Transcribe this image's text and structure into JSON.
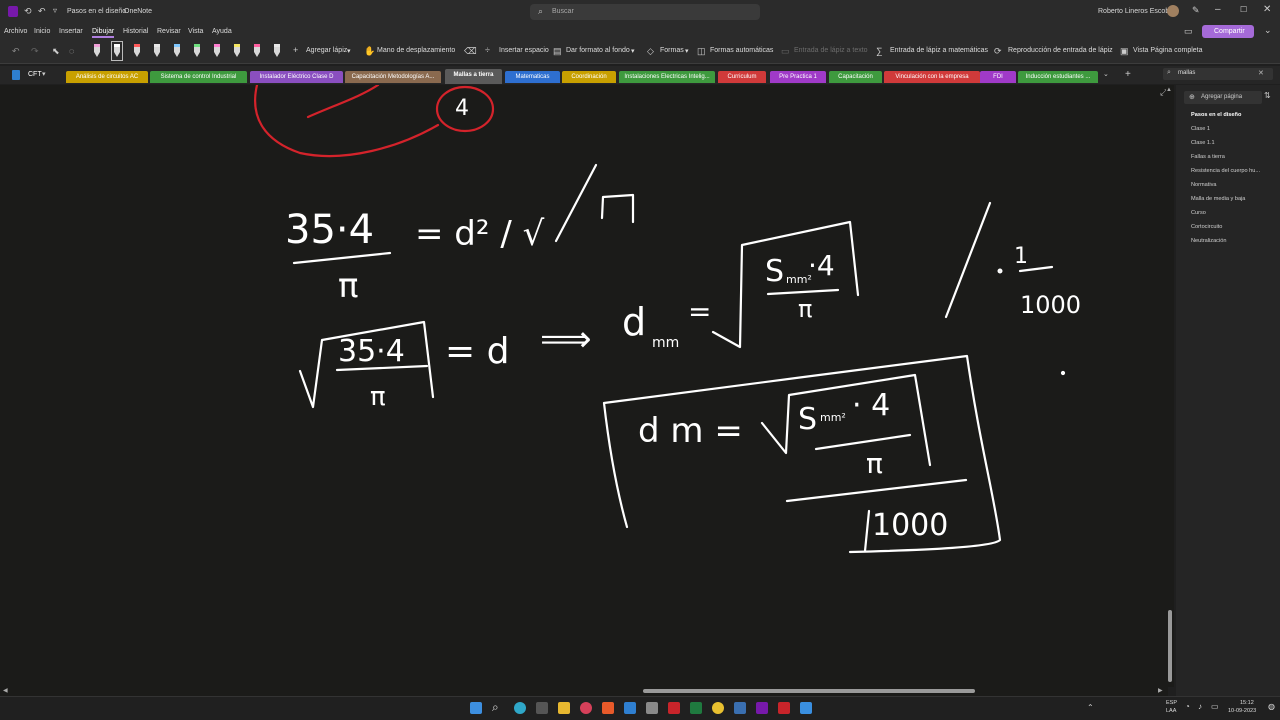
{
  "window": {
    "title": "Pasos en el diseño",
    "app": "OneNote",
    "user": "Roberto Lineros Escobar"
  },
  "search": {
    "placeholder": "Buscar"
  },
  "menu": [
    "Archivo",
    "Inicio",
    "Insertar",
    "Dibujar",
    "Historial",
    "Revisar",
    "Vista",
    "Ayuda"
  ],
  "menu_active": "Dibujar",
  "share_label": "Compartir",
  "ribbon": {
    "add_pen": "Agregar lápiz",
    "hand": "Mano de desplazamiento",
    "insert_space": "Insertar espacio",
    "format_bg": "Dar formato al fondo",
    "shapes": "Formas",
    "auto_shapes": "Formas automáticas",
    "ink_to_text": "Entrada de lápiz a texto",
    "ink_to_math": "Entrada de lápiz a matemáticas",
    "ink_replay": "Reproducción de entrada de lápiz",
    "full_page": "Vista Página completa"
  },
  "pen_colors": [
    "#f0a0d8",
    "#ffffff",
    "#ff5a5a",
    "#e8e8e8",
    "#7fc7ff",
    "#6fe07f",
    "#ff7fd0",
    "#f5e663",
    "#ff5fa0",
    "#e8e8e8"
  ],
  "notebook": "CFT",
  "sections": [
    {
      "label": "Análisis de circuitos AC",
      "color": "#c8a000"
    },
    {
      "label": "Sistema de control Industrial",
      "color": "#3e9a3e"
    },
    {
      "label": "Instalador Eléctrico Clase D",
      "color": "#8a4fc0"
    },
    {
      "label": "Capacitación Metodologías A...",
      "color": "#8a6a4f"
    },
    {
      "label": "Mallas a tierra",
      "color": "#5a5a5a"
    },
    {
      "label": "Matematicas",
      "color": "#2e6fd0"
    },
    {
      "label": "Coordinación",
      "color": "#c8a000"
    },
    {
      "label": "Instalaciones Electricas Intelig...",
      "color": "#3e9a3e"
    },
    {
      "label": "Curriculum",
      "color": "#d03a3a"
    },
    {
      "label": "Pre Practica 1",
      "color": "#a03ac8"
    },
    {
      "label": "Capacitación",
      "color": "#3e9a3e"
    },
    {
      "label": "Vinculación con la empresa",
      "color": "#d03a3a"
    },
    {
      "label": "FDI",
      "color": "#a03ac8"
    },
    {
      "label": "Inducción estudiantes ...",
      "color": "#3e9a3e"
    }
  ],
  "section_search_value": "mallas",
  "add_page": "Agregar página",
  "pages": [
    {
      "label": "Pasos en el diseño",
      "selected": true
    },
    {
      "label": "Clase 1"
    },
    {
      "label": "Clase 1.1"
    },
    {
      "label": "Fallas a tierra"
    },
    {
      "label": "Resistencia del cuerpo hu..."
    },
    {
      "label": "Normativa"
    },
    {
      "label": "Malla de media y baja"
    },
    {
      "label": "Curso"
    },
    {
      "label": "Cortocircuito"
    },
    {
      "label": "Neutralización"
    }
  ],
  "ink_text": {
    "four_circled": "4",
    "eq1_num": "35·4",
    "eq1_den": "π",
    "eq1_rhs": "= d² / √",
    "eq2_lhs_num": "35·4",
    "eq2_lhs_den": "π",
    "eq2_rhs": "= d",
    "implies": "⟹",
    "dmm": "d",
    "dmm_sub": "mm",
    "eq3_eq": "=",
    "eq3_num": "S",
    "eq3_num_sub": "mm²",
    "eq3_num_tail": "·4",
    "eq3_den": "π",
    "side_one": "1",
    "side_thousand": "1000",
    "box_lhs": "d m =",
    "box_num": "S",
    "box_num_sub": "mm²",
    "box_num_tail": "· 4",
    "box_den": "π",
    "box_thousand": "1000"
  },
  "tray": {
    "lang": "ESP",
    "lang2": "LAA",
    "time": "15:12",
    "date": "10-09-2023"
  }
}
